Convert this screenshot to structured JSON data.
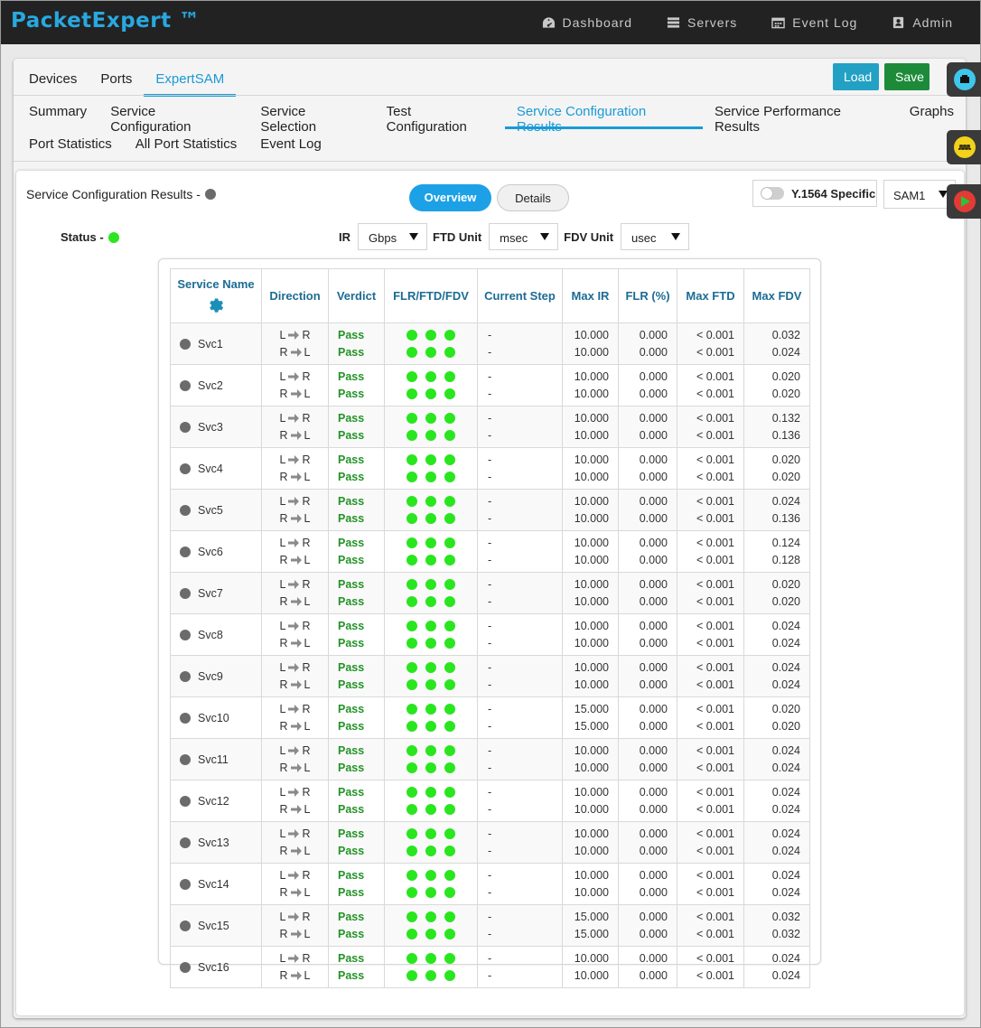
{
  "app": {
    "brand": "PacketExpert ™",
    "nav": [
      {
        "label": "Dashboard",
        "icon": "dashboard-icon"
      },
      {
        "label": "Servers",
        "icon": "servers-icon"
      },
      {
        "label": "Event Log",
        "icon": "calendar-icon"
      },
      {
        "label": "Admin",
        "icon": "admin-icon"
      }
    ]
  },
  "tabs_top": [
    "Devices",
    "Ports",
    "ExpertSAM"
  ],
  "tabs_top_active": "ExpertSAM",
  "buttons": {
    "load": "Load",
    "save": "Save"
  },
  "tabs_sub": [
    "Summary",
    "Service Configuration",
    "Service Selection",
    "Test Configuration",
    "Service Configuration Results",
    "Service Performance Results",
    "Graphs"
  ],
  "tabs_sub_active": "Service Configuration Results",
  "tabs_sub2": [
    "Port Statistics",
    "All Port Statistics",
    "Event Log"
  ],
  "content": {
    "title": "Service Configuration Results -",
    "view_overview": "Overview",
    "view_details": "Details",
    "y1564_label": "Y.1564 Specific",
    "sam_selected": "SAM1",
    "status_label": "Status -",
    "ir_label": "IR",
    "ir_value": "Gbps",
    "ftd_label": "FTD Unit",
    "ftd_value": "msec",
    "fdv_label": "FDV Unit",
    "fdv_value": "usec"
  },
  "table": {
    "headers": [
      "Service Name",
      "Direction",
      "Verdict",
      "FLR/FTD/FDV",
      "Current Step",
      "Max IR",
      "FLR (%)",
      "Max FTD",
      "Max FDV"
    ],
    "rows": [
      {
        "name": "Svc1",
        "dir": [
          "L",
          "R",
          "R",
          "L"
        ],
        "verdict": [
          "Pass",
          "Pass"
        ],
        "step": [
          "-",
          "-"
        ],
        "ir": [
          "10.000",
          "10.000"
        ],
        "flr": [
          "0.000",
          "0.000"
        ],
        "ftd": [
          "< 0.001",
          "< 0.001"
        ],
        "fdv": [
          "0.032",
          "0.024"
        ]
      },
      {
        "name": "Svc2",
        "dir": [
          "L",
          "R",
          "R",
          "L"
        ],
        "verdict": [
          "Pass",
          "Pass"
        ],
        "step": [
          "-",
          "-"
        ],
        "ir": [
          "10.000",
          "10.000"
        ],
        "flr": [
          "0.000",
          "0.000"
        ],
        "ftd": [
          "< 0.001",
          "< 0.001"
        ],
        "fdv": [
          "0.020",
          "0.020"
        ]
      },
      {
        "name": "Svc3",
        "dir": [
          "L",
          "R",
          "R",
          "L"
        ],
        "verdict": [
          "Pass",
          "Pass"
        ],
        "step": [
          "-",
          "-"
        ],
        "ir": [
          "10.000",
          "10.000"
        ],
        "flr": [
          "0.000",
          "0.000"
        ],
        "ftd": [
          "< 0.001",
          "< 0.001"
        ],
        "fdv": [
          "0.132",
          "0.136"
        ]
      },
      {
        "name": "Svc4",
        "dir": [
          "L",
          "R",
          "R",
          "L"
        ],
        "verdict": [
          "Pass",
          "Pass"
        ],
        "step": [
          "-",
          "-"
        ],
        "ir": [
          "10.000",
          "10.000"
        ],
        "flr": [
          "0.000",
          "0.000"
        ],
        "ftd": [
          "< 0.001",
          "< 0.001"
        ],
        "fdv": [
          "0.020",
          "0.020"
        ]
      },
      {
        "name": "Svc5",
        "dir": [
          "L",
          "R",
          "R",
          "L"
        ],
        "verdict": [
          "Pass",
          "Pass"
        ],
        "step": [
          "-",
          "-"
        ],
        "ir": [
          "10.000",
          "10.000"
        ],
        "flr": [
          "0.000",
          "0.000"
        ],
        "ftd": [
          "< 0.001",
          "< 0.001"
        ],
        "fdv": [
          "0.024",
          "0.136"
        ]
      },
      {
        "name": "Svc6",
        "dir": [
          "L",
          "R",
          "R",
          "L"
        ],
        "verdict": [
          "Pass",
          "Pass"
        ],
        "step": [
          "-",
          "-"
        ],
        "ir": [
          "10.000",
          "10.000"
        ],
        "flr": [
          "0.000",
          "0.000"
        ],
        "ftd": [
          "< 0.001",
          "< 0.001"
        ],
        "fdv": [
          "0.124",
          "0.128"
        ]
      },
      {
        "name": "Svc7",
        "dir": [
          "L",
          "R",
          "R",
          "L"
        ],
        "verdict": [
          "Pass",
          "Pass"
        ],
        "step": [
          "-",
          "-"
        ],
        "ir": [
          "10.000",
          "10.000"
        ],
        "flr": [
          "0.000",
          "0.000"
        ],
        "ftd": [
          "< 0.001",
          "< 0.001"
        ],
        "fdv": [
          "0.020",
          "0.020"
        ]
      },
      {
        "name": "Svc8",
        "dir": [
          "L",
          "R",
          "R",
          "L"
        ],
        "verdict": [
          "Pass",
          "Pass"
        ],
        "step": [
          "-",
          "-"
        ],
        "ir": [
          "10.000",
          "10.000"
        ],
        "flr": [
          "0.000",
          "0.000"
        ],
        "ftd": [
          "< 0.001",
          "< 0.001"
        ],
        "fdv": [
          "0.024",
          "0.024"
        ]
      },
      {
        "name": "Svc9",
        "dir": [
          "L",
          "R",
          "R",
          "L"
        ],
        "verdict": [
          "Pass",
          "Pass"
        ],
        "step": [
          "-",
          "-"
        ],
        "ir": [
          "10.000",
          "10.000"
        ],
        "flr": [
          "0.000",
          "0.000"
        ],
        "ftd": [
          "< 0.001",
          "< 0.001"
        ],
        "fdv": [
          "0.024",
          "0.024"
        ]
      },
      {
        "name": "Svc10",
        "dir": [
          "L",
          "R",
          "R",
          "L"
        ],
        "verdict": [
          "Pass",
          "Pass"
        ],
        "step": [
          "-",
          "-"
        ],
        "ir": [
          "15.000",
          "15.000"
        ],
        "flr": [
          "0.000",
          "0.000"
        ],
        "ftd": [
          "< 0.001",
          "< 0.001"
        ],
        "fdv": [
          "0.020",
          "0.020"
        ]
      },
      {
        "name": "Svc11",
        "dir": [
          "L",
          "R",
          "R",
          "L"
        ],
        "verdict": [
          "Pass",
          "Pass"
        ],
        "step": [
          "-",
          "-"
        ],
        "ir": [
          "10.000",
          "10.000"
        ],
        "flr": [
          "0.000",
          "0.000"
        ],
        "ftd": [
          "< 0.001",
          "< 0.001"
        ],
        "fdv": [
          "0.024",
          "0.024"
        ]
      },
      {
        "name": "Svc12",
        "dir": [
          "L",
          "R",
          "R",
          "L"
        ],
        "verdict": [
          "Pass",
          "Pass"
        ],
        "step": [
          "-",
          "-"
        ],
        "ir": [
          "10.000",
          "10.000"
        ],
        "flr": [
          "0.000",
          "0.000"
        ],
        "ftd": [
          "< 0.001",
          "< 0.001"
        ],
        "fdv": [
          "0.024",
          "0.024"
        ]
      },
      {
        "name": "Svc13",
        "dir": [
          "L",
          "R",
          "R",
          "L"
        ],
        "verdict": [
          "Pass",
          "Pass"
        ],
        "step": [
          "-",
          "-"
        ],
        "ir": [
          "10.000",
          "10.000"
        ],
        "flr": [
          "0.000",
          "0.000"
        ],
        "ftd": [
          "< 0.001",
          "< 0.001"
        ],
        "fdv": [
          "0.024",
          "0.024"
        ]
      },
      {
        "name": "Svc14",
        "dir": [
          "L",
          "R",
          "R",
          "L"
        ],
        "verdict": [
          "Pass",
          "Pass"
        ],
        "step": [
          "-",
          "-"
        ],
        "ir": [
          "10.000",
          "10.000"
        ],
        "flr": [
          "0.000",
          "0.000"
        ],
        "ftd": [
          "< 0.001",
          "< 0.001"
        ],
        "fdv": [
          "0.024",
          "0.024"
        ]
      },
      {
        "name": "Svc15",
        "dir": [
          "L",
          "R",
          "R",
          "L"
        ],
        "verdict": [
          "Pass",
          "Pass"
        ],
        "step": [
          "-",
          "-"
        ],
        "ir": [
          "15.000",
          "15.000"
        ],
        "flr": [
          "0.000",
          "0.000"
        ],
        "ftd": [
          "< 0.001",
          "< 0.001"
        ],
        "fdv": [
          "0.032",
          "0.032"
        ]
      },
      {
        "name": "Svc16",
        "dir": [
          "L",
          "R",
          "R",
          "L"
        ],
        "verdict": [
          "Pass",
          "Pass"
        ],
        "step": [
          "-",
          "-"
        ],
        "ir": [
          "10.000",
          "10.000"
        ],
        "flr": [
          "0.000",
          "0.000"
        ],
        "ftd": [
          "< 0.001",
          "< 0.001"
        ],
        "fdv": [
          "0.024",
          "0.024"
        ]
      }
    ]
  },
  "colors": {
    "brand": "#29a8e0",
    "accent": "#1a9ad6",
    "pass": "#239326",
    "status_ok": "#29e61e",
    "neutral_dot": "#6b6b6b",
    "load_button": "#22a1c4",
    "save_button": "#1d8a3a"
  },
  "float_buttons": [
    {
      "icon": "network-port-icon",
      "color": "#3fc6ec"
    },
    {
      "icon": "waveform-icon",
      "color": "#f2d21a"
    },
    {
      "icon": "play-icon",
      "color": "#e23b36"
    }
  ]
}
